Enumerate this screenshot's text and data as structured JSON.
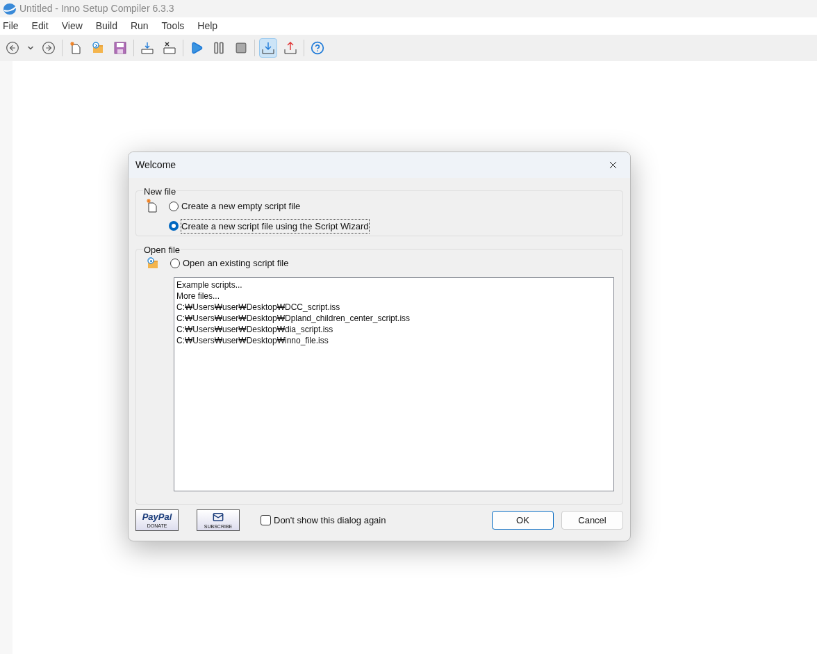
{
  "window": {
    "title": "Untitled - Inno Setup Compiler 6.3.3"
  },
  "menu": [
    "File",
    "Edit",
    "View",
    "Build",
    "Run",
    "Tools",
    "Help"
  ],
  "toolbar": [
    [
      {
        "kind": "back",
        "pressed": false
      },
      {
        "kind": "dropdown",
        "pressed": false
      },
      {
        "kind": "forward",
        "pressed": false
      }
    ],
    [
      {
        "kind": "new",
        "pressed": false
      },
      {
        "kind": "open",
        "pressed": false
      },
      {
        "kind": "save",
        "pressed": false
      }
    ],
    [
      {
        "kind": "compile",
        "pressed": false
      },
      {
        "kind": "stopcompile",
        "pressed": false
      }
    ],
    [
      {
        "kind": "run",
        "pressed": false
      },
      {
        "kind": "pause",
        "pressed": false
      },
      {
        "kind": "stop",
        "pressed": false
      }
    ],
    [
      {
        "kind": "install",
        "pressed": true
      },
      {
        "kind": "uninstall",
        "pressed": false
      }
    ],
    [
      {
        "kind": "help",
        "pressed": false
      }
    ]
  ],
  "dialog": {
    "title": "Welcome",
    "new_file": {
      "label": "New file",
      "options": [
        {
          "label": "Create a new empty script file",
          "selected": false
        },
        {
          "label": "Create a new script file using the Script Wizard",
          "selected": true
        }
      ]
    },
    "open_file": {
      "label": "Open file",
      "option": {
        "label": "Open an existing script file",
        "selected": false
      },
      "files": [
        "Example scripts...",
        "More files...",
        "C:₩Users₩user₩Desktop₩DCC_script.iss",
        "C:₩Users₩user₩Desktop₩Dpland_children_center_script.iss",
        "C:₩Users₩user₩Desktop₩dia_script.iss",
        "C:₩Users₩user₩Desktop₩inno_file.iss"
      ]
    },
    "paypal": {
      "brand": "PayPal",
      "caption": "DONATE"
    },
    "subscribe": {
      "caption": "SUBSCRIBE"
    },
    "dont_show": {
      "label": "Don't show this dialog again",
      "checked": false
    },
    "buttons": [
      "OK",
      "Cancel"
    ]
  }
}
